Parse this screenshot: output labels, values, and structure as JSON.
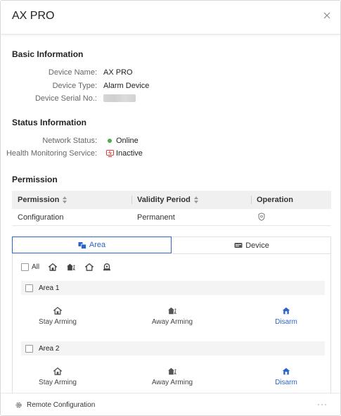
{
  "panel": {
    "title": "AX PRO",
    "close_icon": "close-icon"
  },
  "basic_info": {
    "title": "Basic Information",
    "rows": [
      {
        "label": "Device Name:",
        "value": "AX PRO"
      },
      {
        "label": "Device Type:",
        "value": "Alarm Device"
      },
      {
        "label": "Device Serial No.:",
        "value": ""
      }
    ]
  },
  "status_info": {
    "title": "Status Information",
    "network": {
      "label": "Network Status:",
      "value": "Online",
      "color": "#4caf50"
    },
    "health": {
      "label": "Health Monitoring Service:",
      "value": "Inactive",
      "color": "#e53935",
      "icon": "monitor-icon"
    }
  },
  "permission": {
    "title": "Permission",
    "columns": [
      "Permission",
      "Validity Period",
      "Operation"
    ],
    "rows": [
      {
        "permission": "Configuration",
        "validity": "Permanent",
        "operation_icon": "shield-icon"
      }
    ]
  },
  "tabs": [
    {
      "label": "Area",
      "icon": "area-icon",
      "active": true
    },
    {
      "label": "Device",
      "icon": "device-icon",
      "active": false
    }
  ],
  "filter": {
    "all_label": "All",
    "icons": [
      "stay-arm-icon",
      "away-arm-icon",
      "disarm-icon",
      "clear-alarm-icon"
    ]
  },
  "areas": [
    {
      "name": "Area 1",
      "actions": [
        {
          "label": "Stay Arming",
          "icon": "stay-arm-icon"
        },
        {
          "label": "Away Arming",
          "icon": "away-arm-icon"
        },
        {
          "label": "Disarm",
          "icon": "disarm-icon",
          "highlight": true
        }
      ]
    },
    {
      "name": "Area 2",
      "actions": [
        {
          "label": "Stay Arming",
          "icon": "stay-arm-icon"
        },
        {
          "label": "Away Arming",
          "icon": "away-arm-icon"
        },
        {
          "label": "Disarm",
          "icon": "disarm-icon",
          "highlight": true
        }
      ]
    }
  ],
  "footer": {
    "remote_config_label": "Remote Configuration",
    "more_label": "···"
  },
  "colors": {
    "accent": "#2d64c8",
    "online": "#4caf50",
    "inactive": "#e53935"
  }
}
